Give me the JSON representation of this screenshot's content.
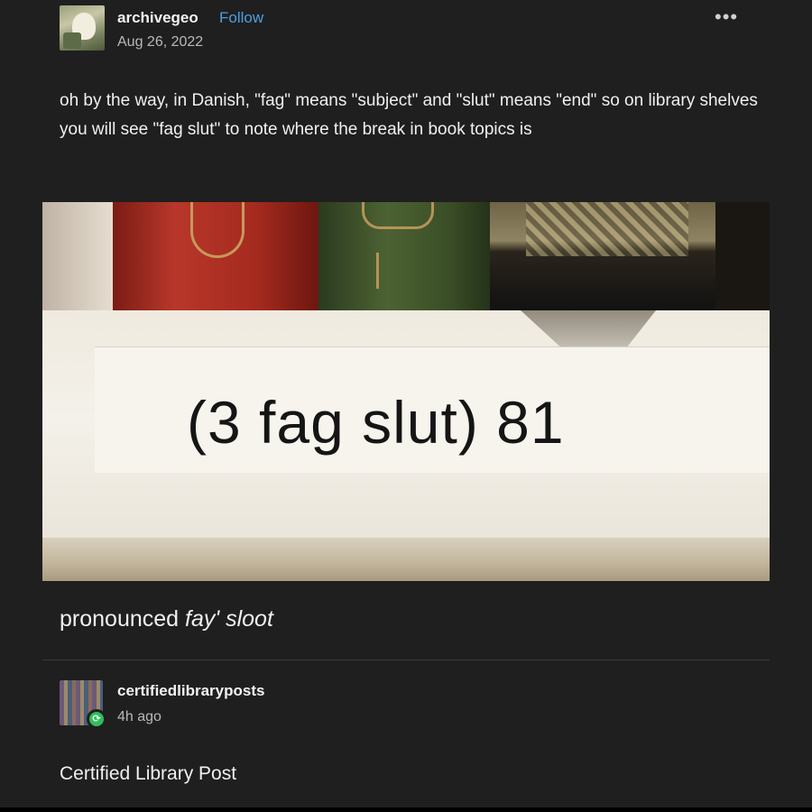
{
  "post": {
    "author": "archivegeo",
    "follow_label": "Follow",
    "date": "Aug 26, 2022",
    "more_icon": "more-horizontal-icon",
    "body": "oh by the way, in Danish, \"fag\" means \"subject\" and \"slut\" means \"end\" so on library shelves you will see \"fag slut\" to note where the break in book topics is",
    "image_label_text": "(3 fag slut) 81",
    "caption_prefix": "pronounced ",
    "caption_italic": "fay' sloot"
  },
  "reblog": {
    "author": "certifiedlibraryposts",
    "time": "4h ago",
    "badge_icon": "reblog-icon",
    "text": "Certified Library Post"
  },
  "colors": {
    "background": "#1f1f1f",
    "follow": "#4d9fe0",
    "badge": "#2fbf5a"
  }
}
